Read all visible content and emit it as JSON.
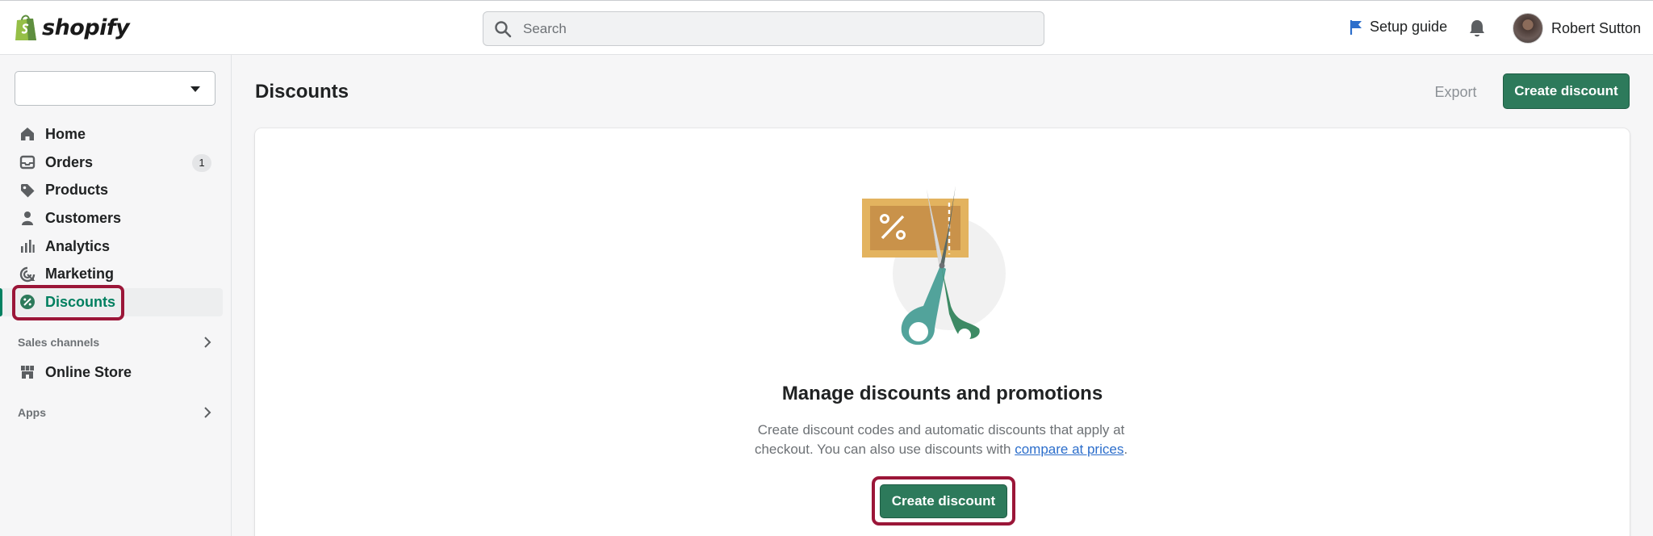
{
  "topbar": {
    "brand": "shopify",
    "search_placeholder": "Search",
    "setup_guide_label": "Setup guide",
    "user_name": "Robert Sutton"
  },
  "sidebar": {
    "items": [
      {
        "label": "Home",
        "icon": "home-icon"
      },
      {
        "label": "Orders",
        "icon": "orders-icon",
        "badge": "1"
      },
      {
        "label": "Products",
        "icon": "tag-icon"
      },
      {
        "label": "Customers",
        "icon": "person-icon"
      },
      {
        "label": "Analytics",
        "icon": "bar-chart-icon"
      },
      {
        "label": "Marketing",
        "icon": "target-icon"
      },
      {
        "label": "Discounts",
        "icon": "discount-icon",
        "active": true
      }
    ],
    "sales_channels_title": "Sales channels",
    "online_store_label": "Online Store",
    "apps_title": "Apps"
  },
  "main": {
    "title": "Discounts",
    "export_label": "Export",
    "create_label": "Create discount",
    "empty_state": {
      "title": "Manage discounts and promotions",
      "desc_text": "Create discount codes and automatic discounts that apply at checkout. You can also use discounts with ",
      "link_text": "compare at prices",
      "desc_end": ".",
      "button_label": "Create discount"
    }
  },
  "colors": {
    "accent_green": "#2d7a5b",
    "highlight": "#9b1638",
    "active_text": "#007f5f"
  }
}
